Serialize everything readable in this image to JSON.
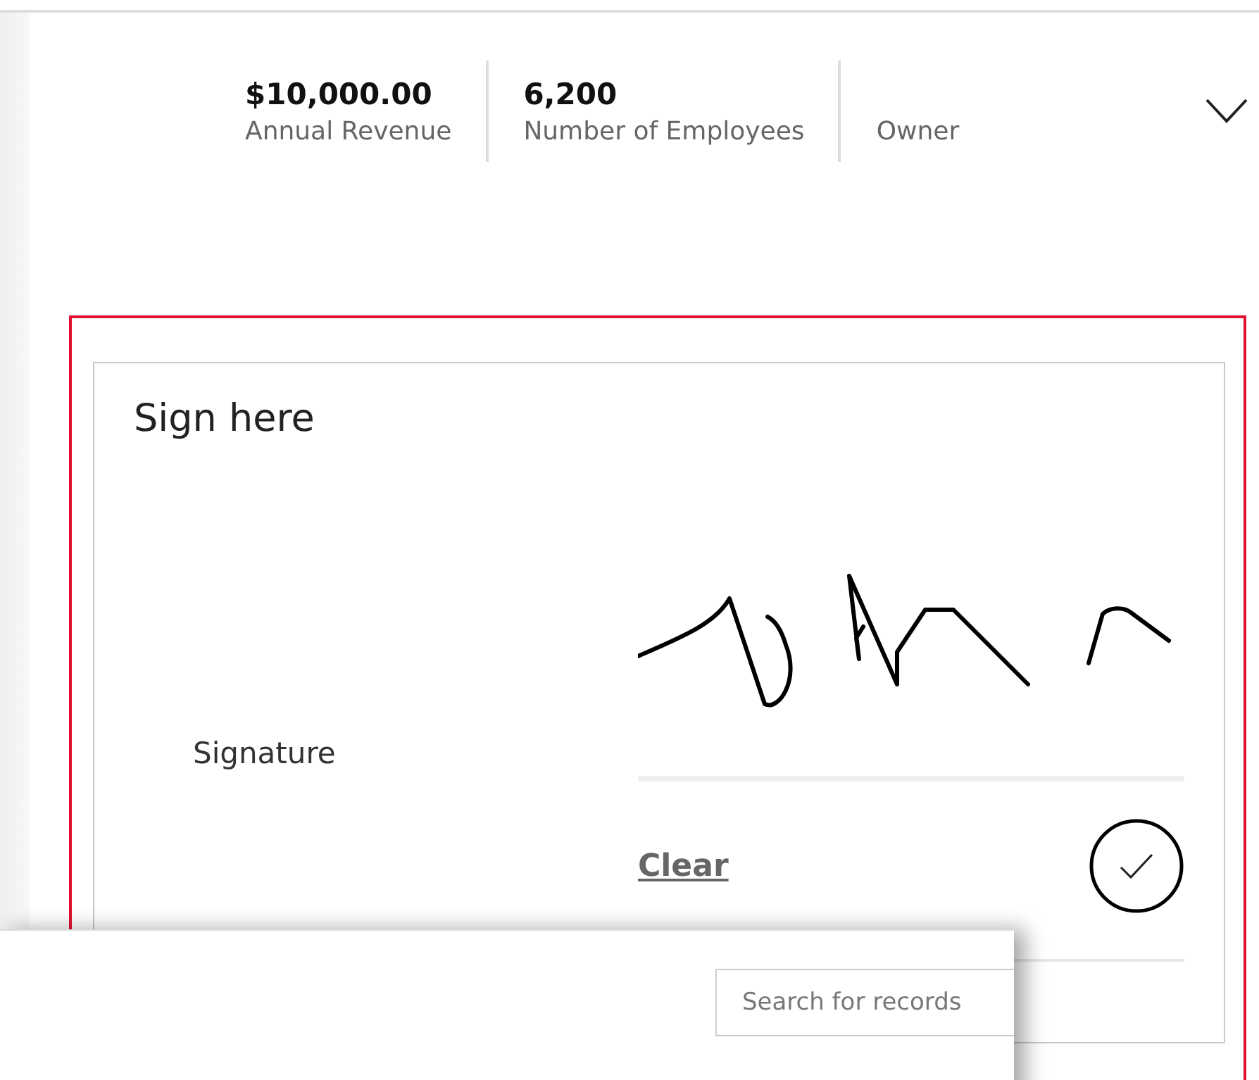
{
  "header_stats": [
    {
      "value": "$10,000.00",
      "label": "Annual Revenue"
    },
    {
      "value": "6,200",
      "label": "Number of Employees"
    },
    {
      "label": "Owner"
    }
  ],
  "signature_card": {
    "title": "Sign here",
    "field_label": "Signature",
    "clear_link": "Clear"
  },
  "search_panel": {
    "placeholder": "Search for records"
  }
}
